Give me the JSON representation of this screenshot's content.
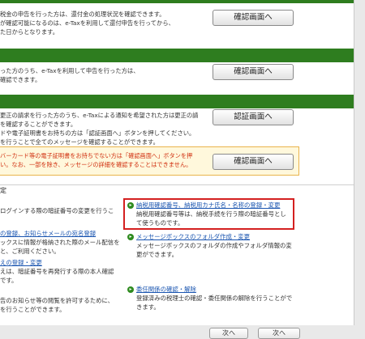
{
  "sections": [
    {
      "lines": [
        "税金の申告を行った方は、還付金の処理状況を確認できます。",
        "が確認可能になるのは、e-Taxを利用して還付申告を行ってから、",
        "た日からとなります。"
      ],
      "button": "確認画面へ"
    },
    {
      "lines": [
        "った方のうち、e-Taxを利用して申告を行った方は、",
        "確認できます。"
      ],
      "button": "確認画面へ"
    },
    {
      "lines": [
        "更正の請求を行った方のうち、e-Taxによる通知を希望された方は更正の請",
        "を確認することができます。",
        "ドや電子証明書をお持ちの方は「認証画面へ」ボタンを押してください。",
        "を行うことで全てのメッセージを確認することができます。"
      ],
      "button": "認証画面へ"
    }
  ],
  "warning": {
    "lines": [
      "バーカード等の電子証明書をお持ちでない方は「確認画面へ」ボタンを押",
      "い。なお、一部を除き、メッセージの詳細を確認することはできません。"
    ],
    "button": "確認画面へ"
  },
  "settings_heading": "定",
  "left_col": [
    {
      "desc": [
        "ログインする際の暗証番号の変更を行うこ"
      ]
    },
    {
      "link": "の登録、お知らせメールの宛名登録",
      "desc": [
        "ックスに情報が格納された際のメール配信を",
        "と、ご利用ください。"
      ]
    },
    {
      "link": "えの登録・変更",
      "desc": [
        "えは、暗証番号を再発行する際の本人確認",
        "です。"
      ]
    },
    {
      "desc": [
        "告のお知らせ等の閲覧を許可するために、",
        "を行うことができます。"
      ]
    }
  ],
  "right_col": [
    {
      "link": "納税用確認番号、納税用カナ氏名・名称の登録・変更",
      "desc": [
        "納税用確認番号等は、納税手続を行う際の暗証番号とし",
        "て使うものです。"
      ]
    },
    {
      "link": "メッセージボックスのフォルダ作成・変更",
      "desc": [
        "メッセージボックスのフォルダの作成やフォルダ情報の変",
        "更ができます。"
      ]
    },
    {
      "link": "委任関係の確認・解除",
      "desc": [
        "登録済みの税理士の確認・委任関係の解除を行うことがで",
        "きます。"
      ]
    }
  ],
  "footer": {
    "left_button": "次へ",
    "right_button": "次へ"
  }
}
